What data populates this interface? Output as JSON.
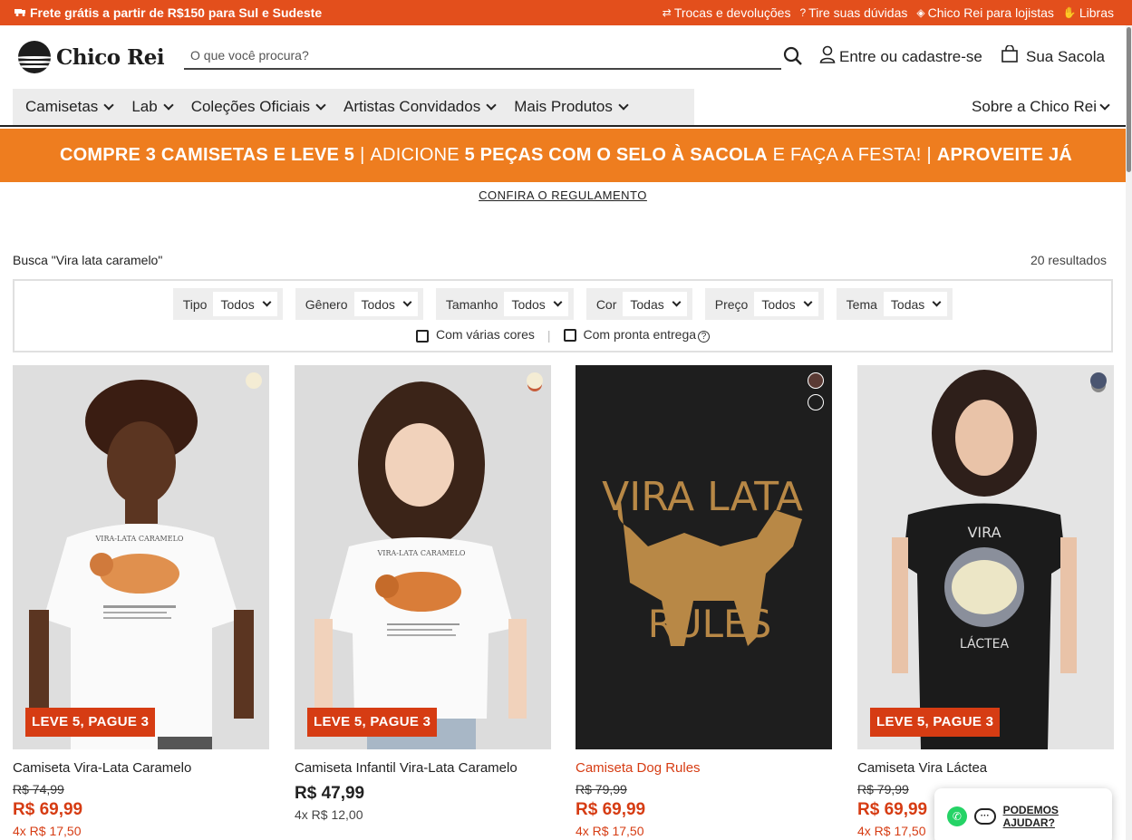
{
  "topbar": {
    "promo": "Frete grátis a partir de R$150 para Sul e Sudeste",
    "links": [
      "Trocas e devoluções",
      "Tire suas dúvidas",
      "Chico Rei para lojistas",
      "Libras"
    ]
  },
  "header": {
    "logo_text": "Chico Rei",
    "search_placeholder": "O que você procura?",
    "account_label": "Entre ou cadastre-se",
    "bag_label": "Sua Sacola"
  },
  "nav": {
    "items": [
      "Camisetas",
      "Lab",
      "Coleções Oficiais",
      "Artistas Convidados",
      "Mais Produtos"
    ],
    "right_item": "Sobre a Chico Rei"
  },
  "banner": {
    "part1": "COMPRE 3 CAMISETAS E LEVE 5",
    "part2": "ADICIONE",
    "part3": "5 PEÇAS COM O SELO À SACOLA",
    "part4": "E FAÇA A FESTA!",
    "part5": "APROVEITE JÁ",
    "separator": "|",
    "rules_link": "CONFIRA O REGULAMENTO"
  },
  "search_info": {
    "query_label": "Busca \"Vira lata caramelo\"",
    "results": "20 resultados"
  },
  "filters": [
    {
      "label": "Tipo",
      "value": "Todos"
    },
    {
      "label": "Gênero",
      "value": "Todos"
    },
    {
      "label": "Tamanho",
      "value": "Todos"
    },
    {
      "label": "Cor",
      "value": "Todas"
    },
    {
      "label": "Preço",
      "value": "Todos"
    },
    {
      "label": "Tema",
      "value": "Todas"
    }
  ],
  "checkboxes": {
    "multi_color": "Com várias cores",
    "ready": "Com pronta entrega",
    "separator": "|"
  },
  "products": [
    {
      "tag": "LEVE 5, PAGUE 3",
      "name": "Camiseta Vira-Lata Caramelo",
      "old_price": "R$ 74,99",
      "price": "R$ 69,99",
      "installments": "4x R$ 17,50"
    },
    {
      "tag": "LEVE 5, PAGUE 3",
      "name": "Camiseta Infantil Vira-Lata Caramelo",
      "old_price": "",
      "price": "R$ 47,99",
      "installments": "4x R$ 12,00"
    },
    {
      "tag": "",
      "name": "Camiseta Dog Rules",
      "old_price": "R$ 79,99",
      "price": "R$ 69,99",
      "installments": "4x R$ 17,50"
    },
    {
      "tag": "LEVE 5, PAGUE 3",
      "name": "Camiseta Vira Láctea",
      "old_price": "R$ 79,99",
      "price": "R$ 69,99",
      "installments": "4x R$ 17,50"
    }
  ],
  "print_text": {
    "p3_line1": "VIRA LATA",
    "p3_line2": "RULES",
    "p4_line1": "VIRA",
    "p4_line2": "LÁCTEA",
    "p1_title": "VIRA-LATA CARAMELO",
    "p2_title": "VIRA-LATA CARAMELO"
  },
  "chat": {
    "label": "PODEMOS AJUDAR?"
  },
  "colors": {
    "accent": "#e34f1c",
    "banner": "#ee7d1f",
    "sale": "#d63c13"
  }
}
